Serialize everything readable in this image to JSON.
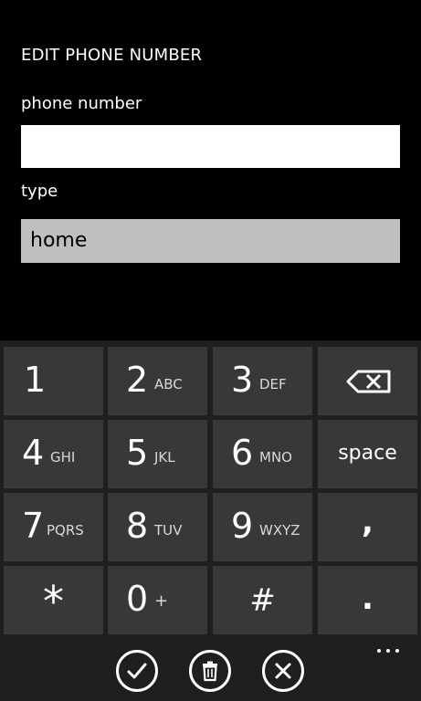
{
  "page": {
    "title": "EDIT PHONE NUMBER"
  },
  "form": {
    "phone_label": "phone number",
    "phone_value": "",
    "type_label": "type",
    "type_value": "home"
  },
  "keypad": {
    "keys": [
      {
        "num": "1",
        "letters": ""
      },
      {
        "num": "2",
        "letters": "ABC"
      },
      {
        "num": "3",
        "letters": "DEF"
      },
      {
        "num": "4",
        "letters": "GHI"
      },
      {
        "num": "5",
        "letters": "JKL"
      },
      {
        "num": "6",
        "letters": "MNO"
      },
      {
        "num": "7",
        "letters": "PQRS"
      },
      {
        "num": "8",
        "letters": "TUV"
      },
      {
        "num": "9",
        "letters": "WXYZ"
      },
      {
        "num": "0",
        "letters": "+"
      }
    ],
    "space_label": "space",
    "comma_label": ",",
    "star_label": "*",
    "hash_label": "#",
    "period_label": ".",
    "backspace_icon": "backspace-icon"
  },
  "appbar": {
    "save_icon": "check-icon",
    "delete_icon": "trash-icon",
    "cancel_icon": "close-icon",
    "more_icon": "ellipsis-icon"
  },
  "colors": {
    "background": "#000000",
    "input_bg": "#ffffff",
    "select_bg": "#bfbfbf",
    "keypad_bg": "#1f1f1f",
    "key_bg": "#383838"
  }
}
